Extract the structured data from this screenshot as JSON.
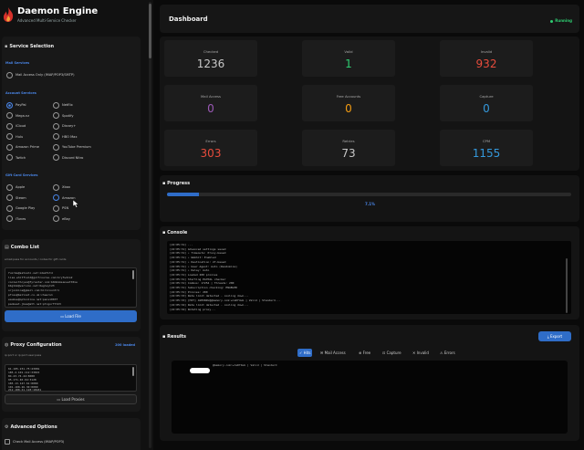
{
  "app": {
    "title": "Daemon Engine",
    "subtitle": "Advanced Multi-Service Checker"
  },
  "sidebar": {
    "service_selection": {
      "title": "Service Selection",
      "mail_services_heading": "Mail Services",
      "mail_option": "Mail Access Only (IMAP/POP3/SMTP)",
      "account_services_heading": "Account Services",
      "account_services": [
        "PayPal",
        "Netflix",
        "Mega.nz",
        "Spotify",
        "iCloud",
        "Disney+",
        "Hulu",
        "HBO Max",
        "Amazon Prime",
        "YouTube Premium",
        "Twitch",
        "Discord Nitro"
      ],
      "selected": "PayPal",
      "gift_card_heading": "Gift Card Services",
      "gift_card_services": [
        "Apple",
        "Xbox",
        "Steam",
        "Amazon",
        "Google Play",
        "PSN",
        "iTunes",
        "eBay"
      ],
      "hovered": "Amazon"
    },
    "combo_list": {
      "title": "Combo List",
      "hint": "email:pass for accounts / codes for gift cards",
      "lines": [
        "fuxrma@satoshi.net:zdakfntd",
        "lisa.whitfield@golfcourse.com:kryfwdzs2",
        "coolwithcyan@fyrestar.com:bXmhAAsanwatt0xe",
        "bbglkm@verizon.net:6eglayt23",
        "srjonkins@gmail.com:hillcountr1",
        "pfcas@bellnet.co.uk:cheers1",
        "eaumse@optonline.net:pens1003f",
        "panbeat.jbas@att.net:ptigorftt23"
      ],
      "load_button": "Load File"
    },
    "proxy_config": {
      "title": "Proxy Configuration",
      "loaded": "200 loaded",
      "hint": "ip:port or ip:port:user:pass",
      "lines": [
        "61.185.231.75:43081",
        "185.2.101.112:33815",
        "84.43.74.44:8080",
        "95.171.40.94:3128",
        "185.13.147.61:8080",
        "101.108.26.30:8080",
        "212.188.41.128:18181"
      ],
      "load_button": "Load Proxies"
    },
    "advanced": {
      "title": "Advanced Options",
      "check_option": "Check Mail Access (IMAP/POP3)"
    }
  },
  "dashboard": {
    "title": "Dashboard",
    "status": "Running",
    "stats": [
      {
        "label": "Checked",
        "value": "1236",
        "color": "#c8c8c8"
      },
      {
        "label": "Valid",
        "value": "1",
        "color": "#2ecc71"
      },
      {
        "label": "Invalid",
        "value": "932",
        "color": "#e74c3c"
      },
      {
        "label": "Mail Access",
        "value": "0",
        "color": "#9b59b6"
      },
      {
        "label": "Free Accounts",
        "value": "0",
        "color": "#f39c12"
      },
      {
        "label": "Capture",
        "value": "0",
        "color": "#3498db"
      },
      {
        "label": "Errors",
        "value": "303",
        "color": "#e74c3c"
      },
      {
        "label": "Retries",
        "value": "73",
        "color": "#c8c8c8"
      },
      {
        "label": "CPM",
        "value": "1155",
        "color": "#3498db"
      }
    ]
  },
  "progress": {
    "title": "Progress",
    "percent_text": "7.1%",
    "fraction": 0.079
  },
  "console": {
    "title": "Console",
    "lines": [
      "[22:05:31]  ...",
      "[22:05:31]  Advanced settings saved",
      "[22:05:31]  • Timeouts: Proxy-based",
      "[22:05:31]  • Webhit: Enabled",
      "[22:05:31]  • Destination: 27-based",
      "[22:05:31]  • User Agent: Auto (Randomize)",
      "[22:05:31]  • Delay: Auto",
      "[22:05:31]  Loaded 200 proxies",
      "[22:05:31]  Starting PAYPAL checker",
      "[22:05:31]  Combos: 17254 | Threads: 200",
      "[22:05:31]  Subscription checking: ENABLED",
      "[22:05:31]  Proxies: 200",
      "[22:05:33]  Rate limit detected - cooling down...",
      "[22:05:33]  [HIT] ASMINIU@@memory.com:wreDf4ub | Valid | Standard...",
      "[22:05:34]  Rate limit detected - cooling down...",
      "[22:05:34]  Rotating proxy..."
    ]
  },
  "results": {
    "title": "Results",
    "export_label": "Export",
    "tabs": [
      {
        "label": "Hits",
        "icon": "✓"
      },
      {
        "label": "Mail Access",
        "icon": "✉"
      },
      {
        "label": "Free",
        "icon": "⊕"
      },
      {
        "label": "Capture",
        "icon": "⊡"
      },
      {
        "label": "Invalid",
        "icon": "✕"
      },
      {
        "label": "Errors",
        "icon": "⚠"
      }
    ],
    "active_tab": "Hits",
    "line": "@memory.com:wreDf4ub | Valid | Standard"
  },
  "colors": {
    "accent": "#2f6dc8",
    "running": "#2ecc71",
    "brand_flame": "#d6312b"
  }
}
